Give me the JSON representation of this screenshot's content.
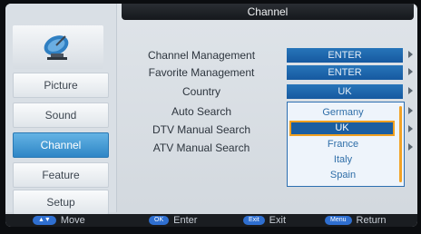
{
  "header": {
    "title": "Channel"
  },
  "sidebar": {
    "items": [
      {
        "label": "Picture",
        "active": false
      },
      {
        "label": "Sound",
        "active": false
      },
      {
        "label": "Channel",
        "active": true
      },
      {
        "label": "Feature",
        "active": false
      },
      {
        "label": "Setup",
        "active": false
      }
    ]
  },
  "menu": {
    "rows": [
      {
        "label": "Channel Management",
        "value": "ENTER"
      },
      {
        "label": "Favorite Management",
        "value": "ENTER"
      },
      {
        "label": "Country",
        "value": "UK"
      },
      {
        "label": "Auto Search",
        "value": ""
      },
      {
        "label": "DTV Manual Search",
        "value": ""
      },
      {
        "label": "ATV Manual Search",
        "value": ""
      }
    ]
  },
  "country_dropdown": {
    "options": [
      "Germany",
      "UK",
      "France",
      "Italy",
      "Spain"
    ],
    "selected": "UK"
  },
  "footer": {
    "move": {
      "key": "▲▼",
      "label": "Move"
    },
    "enter": {
      "key": "OK",
      "label": "Enter"
    },
    "exit": {
      "key": "Exit",
      "label": "Exit"
    },
    "return": {
      "key": "Menu",
      "label": "Return"
    }
  },
  "colors": {
    "accent": "#2f86c6",
    "value_bg": "#1659a0",
    "highlight": "#f0a020"
  },
  "icons": {
    "logo": "satellite-dish-icon"
  }
}
